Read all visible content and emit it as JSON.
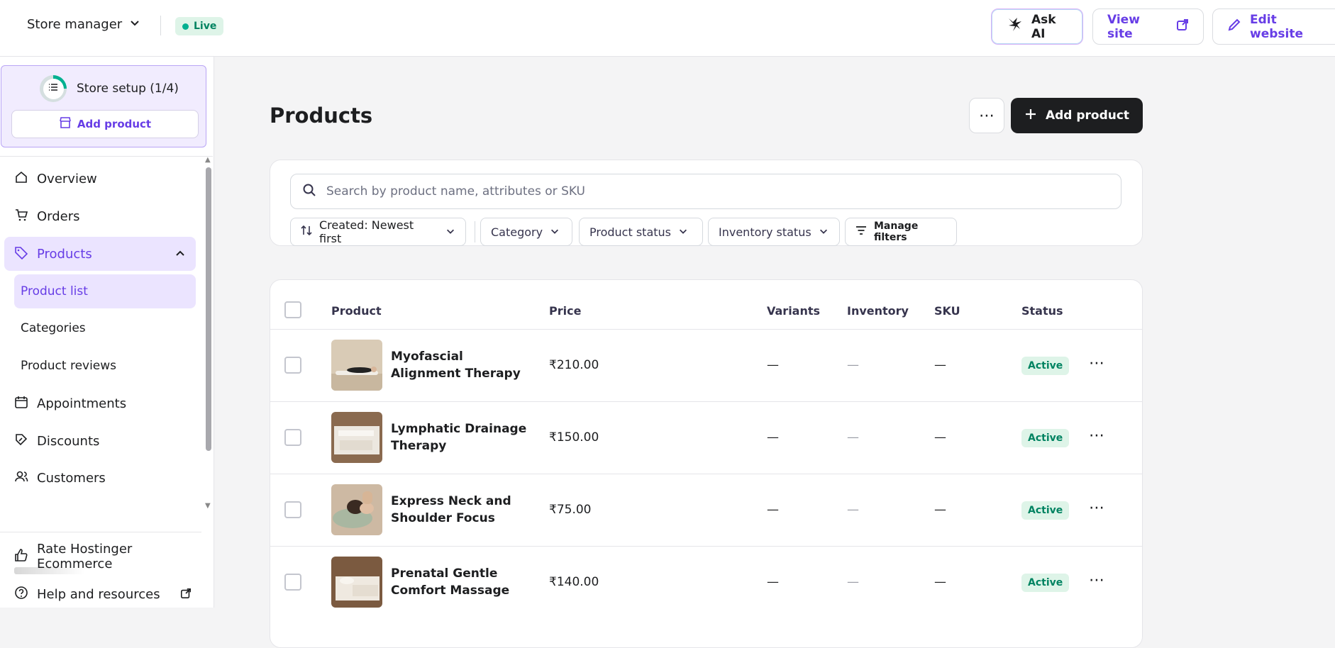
{
  "topbar": {
    "store_label": "Store manager",
    "live_label": "Live",
    "ask_ai_label": "Ask AI",
    "view_site_label": "View site",
    "edit_website_label": "Edit website"
  },
  "sidebar": {
    "setup_label": "Store setup (1/4)",
    "setup_progress": 0.25,
    "setup_add_label": "Add product",
    "items": [
      {
        "label": "Overview",
        "icon": "home-icon"
      },
      {
        "label": "Orders",
        "icon": "cart-icon"
      },
      {
        "label": "Products",
        "icon": "tag-icon"
      },
      {
        "label": "Product list"
      },
      {
        "label": "Categories"
      },
      {
        "label": "Product reviews"
      },
      {
        "label": "Appointments",
        "icon": "calendar-icon"
      },
      {
        "label": "Discounts",
        "icon": "discount-icon"
      },
      {
        "label": "Customers",
        "icon": "customers-icon"
      }
    ],
    "footer": [
      {
        "label": "Rate Hostinger Ecommerce",
        "icon": "thumbs-up-icon"
      },
      {
        "label": "Help and resources",
        "icon": "help-icon"
      }
    ]
  },
  "main": {
    "title": "Products",
    "add_product_label": "Add product",
    "search_placeholder": "Search by product name, attributes or SKU",
    "filters": {
      "sort": "Created: Newest first",
      "category": "Category",
      "product_status": "Product status",
      "inventory_status": "Inventory status",
      "manage": "Manage filters"
    },
    "columns": [
      "Product",
      "Price",
      "Variants",
      "Inventory",
      "SKU",
      "Status"
    ],
    "rows": [
      {
        "name": "Myofascial Alignment Therapy",
        "price": "₹210.00",
        "variants": "—",
        "inventory": "—",
        "sku": "—",
        "status": "Active"
      },
      {
        "name": "Lymphatic Drainage Therapy",
        "price": "₹150.00",
        "variants": "—",
        "inventory": "—",
        "sku": "—",
        "status": "Active"
      },
      {
        "name": "Express Neck and Shoulder Focus",
        "price": "₹75.00",
        "variants": "—",
        "inventory": "—",
        "sku": "—",
        "status": "Active"
      },
      {
        "name": "Prenatal Gentle Comfort Massage",
        "price": "₹140.00",
        "variants": "—",
        "inventory": "—",
        "sku": "—",
        "status": "Active"
      }
    ]
  },
  "colors": {
    "accent": "#673de6",
    "active_status": "#008361",
    "primary_button": "#1d1e20"
  }
}
